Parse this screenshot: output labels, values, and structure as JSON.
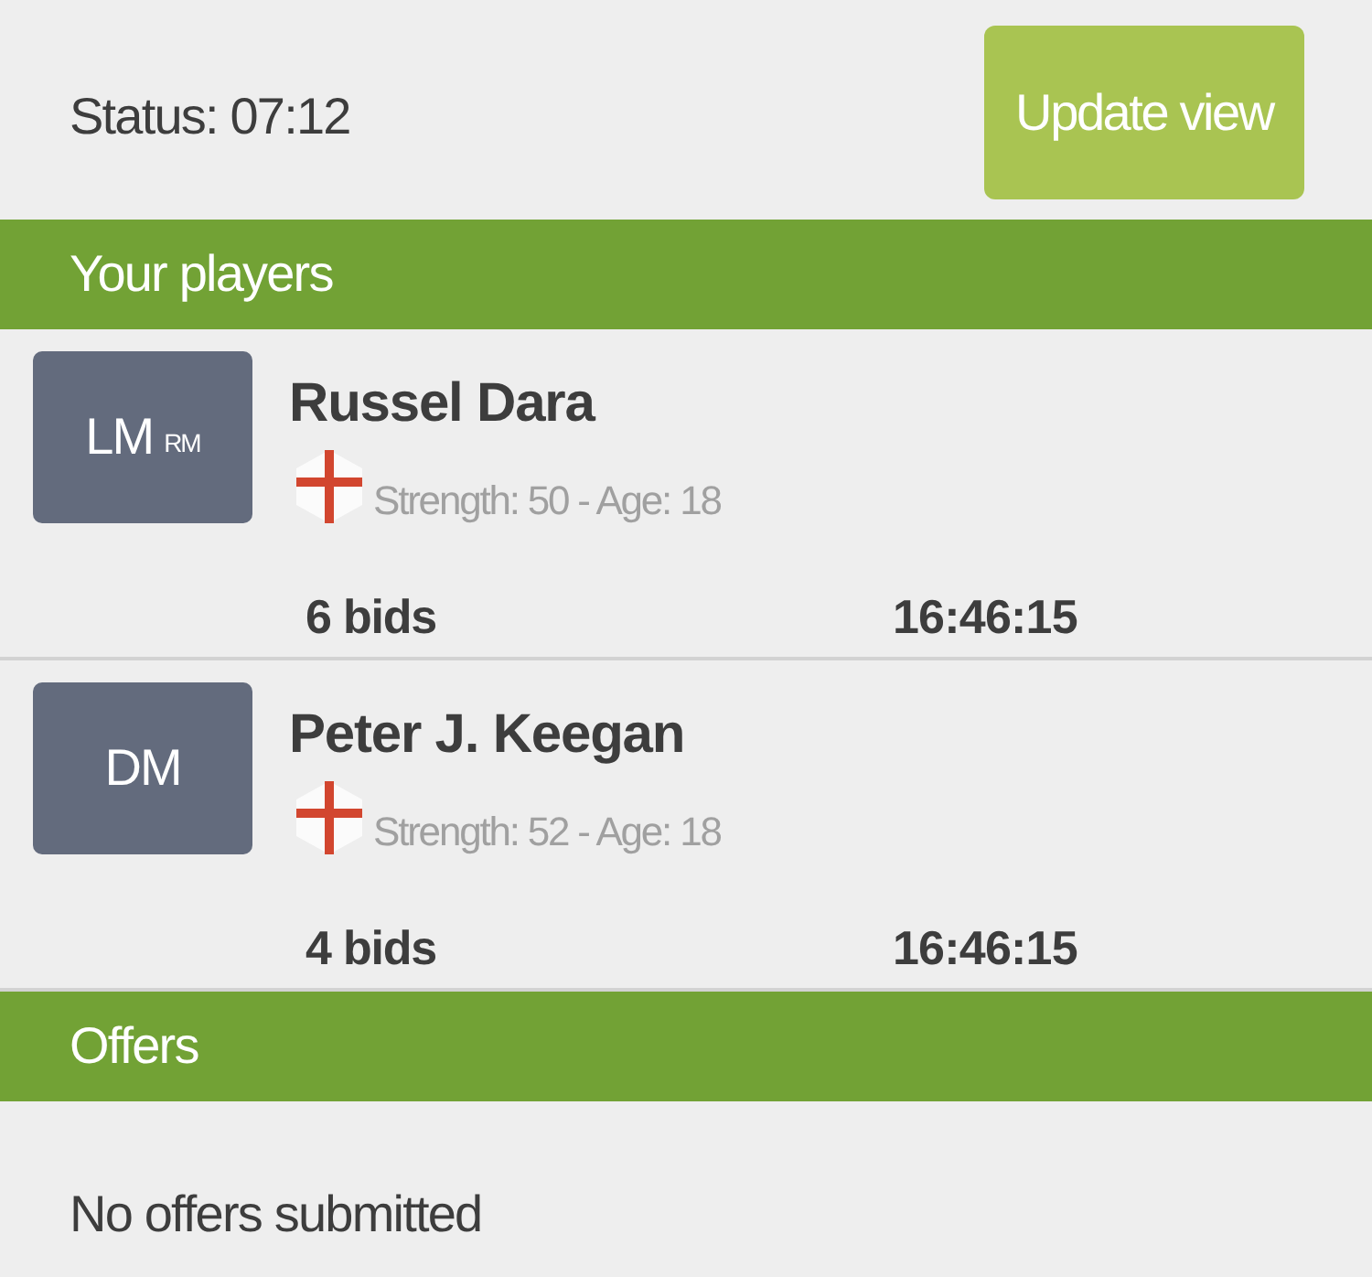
{
  "status": {
    "label": "Status: 07:12"
  },
  "update_button": {
    "label": "Update view"
  },
  "players_section": {
    "title": "Your players",
    "players": [
      {
        "position": "LM",
        "alt_position": "RM",
        "name": "Russel Dara",
        "details": "Strength: 50 - Age: 18",
        "bids": "6 bids",
        "time": "16:46:15"
      },
      {
        "position": "DM",
        "name": "Peter J. Keegan",
        "details": "Strength: 52 - Age: 18",
        "bids": "4 bids",
        "time": "16:46:15"
      }
    ]
  },
  "offers_section": {
    "title": "Offers",
    "empty_message": "No offers submitted"
  }
}
